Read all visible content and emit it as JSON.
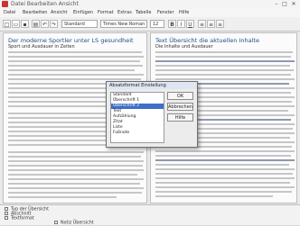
{
  "window": {
    "title": "Datei   Bearbeiten   Ansicht",
    "minimize": "–",
    "maximize": "□",
    "close": "✕"
  },
  "menubar": [
    "Datei",
    "Bearbeiten",
    "Ansicht",
    "Einfügen",
    "Format",
    "Extras",
    "Tabelle",
    "Fenster",
    "Hilfe"
  ],
  "toolbar": {
    "style_value": "Standard",
    "font_value": "Times New Roman",
    "size_value": "12"
  },
  "left_pane": {
    "heading": "Der moderne Sportler unter LS gesundheit",
    "subheading": "Sport und Ausdauer in Zeiten"
  },
  "right_pane": {
    "heading": "Text Übersicht die aktuellen Inhalte",
    "subheading": "Die Inhalte und Ausdauer"
  },
  "dialog": {
    "title": "Absatzformat Einstellung",
    "items": [
      "Standard",
      "Überschrift 1",
      "Überschrift 2",
      "Text",
      "Aufzählung",
      "Zitat",
      "Liste",
      "Fußnote"
    ],
    "selected_index": 2,
    "ok": "OK",
    "cancel": "Abbrechen",
    "help": "Hilfe"
  },
  "bottom_panel": {
    "rows": [
      "Typ der Übersicht",
      "Abschnitt",
      "Textformat",
      "Notiz Übersicht"
    ]
  }
}
